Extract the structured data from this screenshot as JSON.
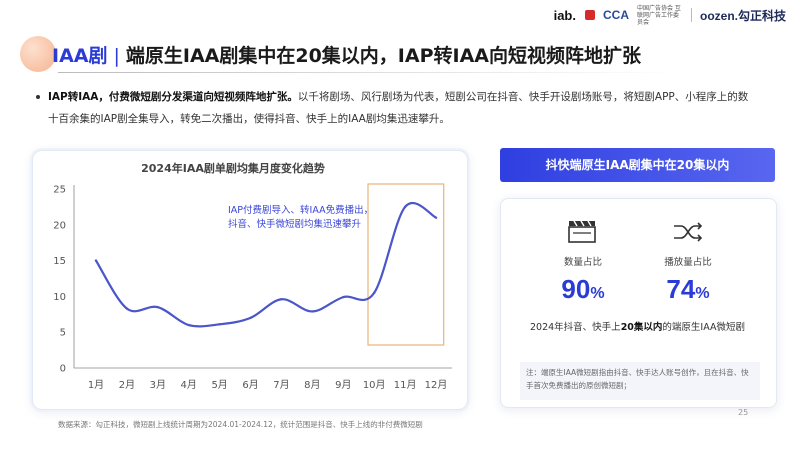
{
  "logos": {
    "iab": "iab.",
    "ca": "CCA",
    "ca_text": "中国广告协会 互联网广告工作委员会",
    "oz": "oozen.勾正科技"
  },
  "title": {
    "prefix": "IAA剧",
    "separator": "|",
    "main": "端原生IAA剧集中在20集以内，IAP转IAA向短视频阵地扩张"
  },
  "bullet": {
    "bold": "IAP转IAA，付费微短剧分发渠道向短视频阵地扩张。",
    "text": "以千将剧场、风行剧场为代表，短剧公司在抖音、快手开设剧场账号，将短剧APP、小程序上的数十百余集的IAP剧全集导入，转免二次播出，使得抖音、快手上的IAA剧均集迅速攀升。"
  },
  "chart_data": {
    "type": "line",
    "title": "2024年IAA剧单剧均集月度变化趋势",
    "categories": [
      "1月",
      "2月",
      "3月",
      "4月",
      "5月",
      "6月",
      "7月",
      "8月",
      "9月",
      "10月",
      "11月",
      "12月"
    ],
    "series": [
      {
        "values": [
          15,
          8.3,
          8.5,
          6,
          6.1,
          7,
          9.6,
          7.9,
          9.9,
          10.5,
          22.5,
          21
        ]
      }
    ],
    "ylim": [
      0,
      25
    ],
    "yticks": [
      0,
      5,
      10,
      15,
      20,
      25
    ],
    "highlight_months": [
      "10月",
      "11月",
      "12月"
    ],
    "annotation": [
      "IAP付费剧导入、转IAA免费播出，",
      "抖音、快手微短剧均集迅速攀升"
    ],
    "line_color": "#4b56c8",
    "highlight_color": "#e7b57a"
  },
  "panel": {
    "header": "抖快端原生IAA剧集中在20集以内",
    "stats": [
      {
        "label": "数量占比",
        "value": "90",
        "unit": "%",
        "icon": "clapperboard-icon"
      },
      {
        "label": "播放量占比",
        "value": "74",
        "unit": "%",
        "icon": "shuffle-icon"
      }
    ],
    "caption_pre": "2024年抖音、快手上",
    "caption_bold": "20集以内",
    "caption_post": "的端原生IAA微短剧",
    "note": "注：端原生IAA微短剧指由抖音、快手达人账号创作，且在抖音、快手首次免费播出的原创微短剧；"
  },
  "source": "数据来源：勾正科技，微短剧上线统计周期为2024.01-2024.12，统计范围是抖音、快手上线的非付费微短剧",
  "page_number": "25",
  "colors": {
    "accent": "#2b3bd6"
  }
}
